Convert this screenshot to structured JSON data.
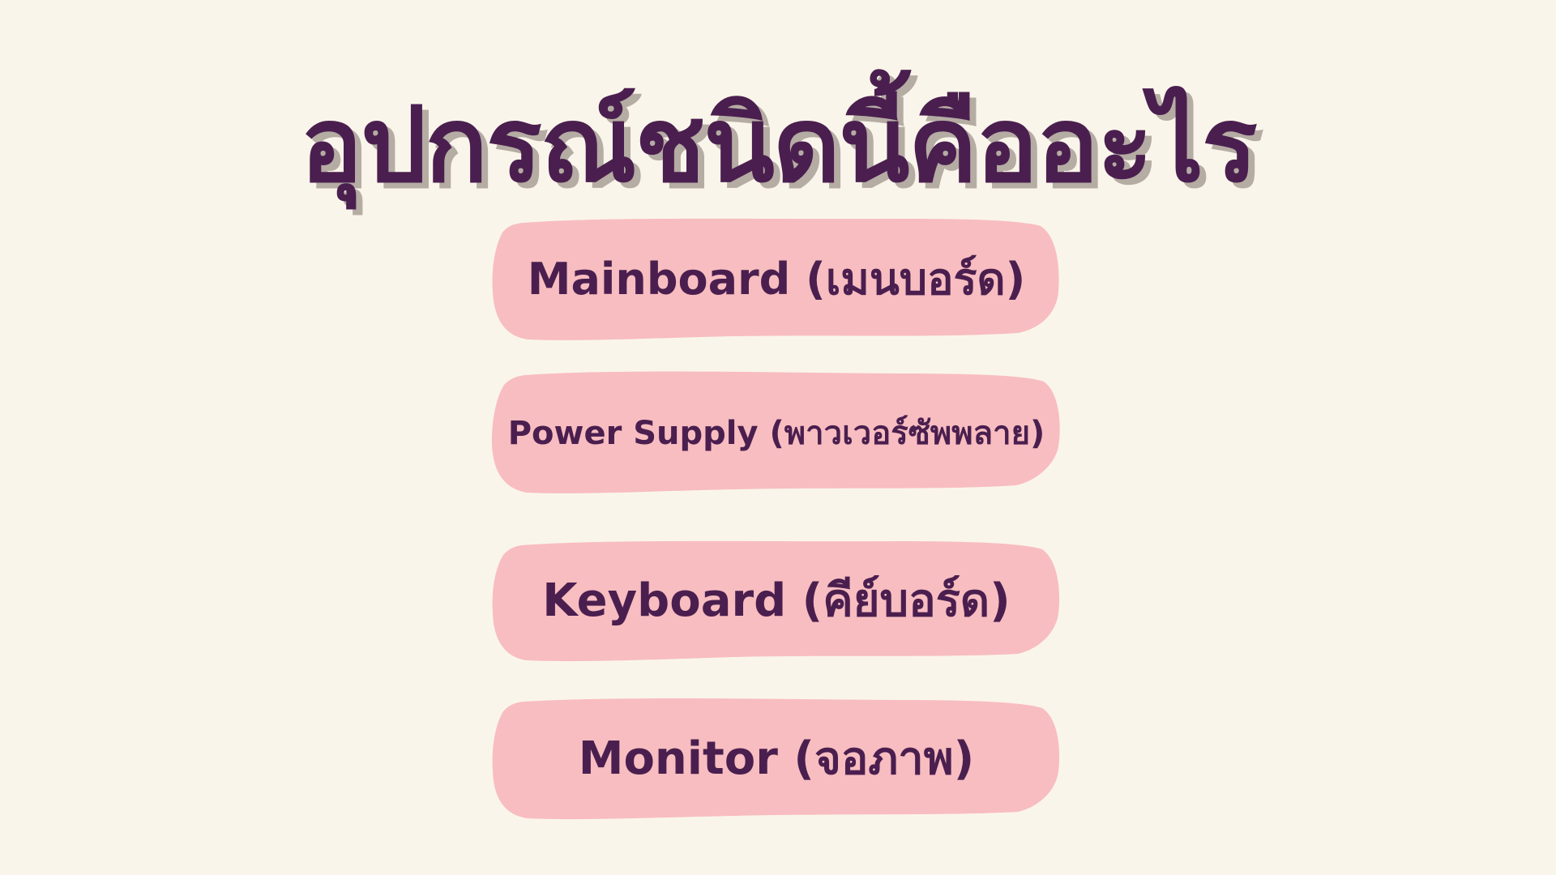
{
  "title": "อุปกรณ์ชนิดนี้คืออะไร",
  "options": [
    {
      "label": "Mainboard (เมนบอร์ด)"
    },
    {
      "label": "Power Supply (พาวเวอร์ซัพพลาย)"
    },
    {
      "label": "Keyboard (คีย์บอร์ด)"
    },
    {
      "label": "Monitor (จอภาพ)"
    }
  ],
  "colors": {
    "background": "#faf5ea",
    "text": "#4a1f4f",
    "title_shadow": "#b5aca3",
    "option_fill": "#f8bdc0"
  }
}
